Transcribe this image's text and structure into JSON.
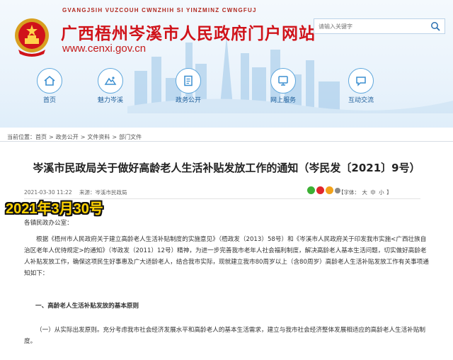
{
  "header": {
    "pinyin": "GVANGJSIH VUZCOUH CWNZHIH SI YINZMINZ CWNGFUJ",
    "title": "广西梧州岑溪市人民政府门户网站",
    "url": "www.cenxi.gov.cn",
    "search_placeholder": "请输入关键字"
  },
  "nav": [
    {
      "label": "首页",
      "icon": "home-icon"
    },
    {
      "label": "魅力岑溪",
      "icon": "scenery-icon"
    },
    {
      "label": "政务公开",
      "icon": "document-icon"
    },
    {
      "label": "网上服务",
      "icon": "service-icon"
    },
    {
      "label": "互动交流",
      "icon": "chat-icon"
    }
  ],
  "breadcrumb": {
    "prefix": "当前位置：",
    "items": [
      "首页",
      "政务公开",
      "文件资料",
      "部门文件"
    ],
    "separator": ">"
  },
  "article": {
    "title": "岑溪市民政局关于做好高龄老人生活补贴发放工作的通知（岑民发〔2021〕9号）",
    "date": "2021-03-30 11:22",
    "source": "来源：岑溪市民政局",
    "fontsize_label": "【字体：",
    "fontsize_options": [
      "大",
      "中",
      "小"
    ],
    "fontsize_end": "】",
    "greeting": "各镇民政办公室：",
    "paragraph1": "根据《梧州市人民政府关于建立高龄老人生活补贴制度的实施意见》（梧政发（2013）58号）和《岑溪市人民政府关于印发我市实施<广西壮族自治区老年人优待规定>的通知》（岑政发（2011）12号）精神，为进一步完善我市老年人社会福利制度，解决高龄老人基本生活问题，切实做好高龄老人补贴发放工作，确保这项民生好事惠及广大适龄老人，结合我市实际，现就建立我市80周岁以上（含80周岁）高龄老人生活补贴发放工作有关事项通知如下：",
    "heading1": "一、高龄老人生活补贴发放的基本原则",
    "paragraph2": "（一）从实际出发原则。充分考虑我市社会经济发展水平和高龄老人的基本生活需求，建立与我市社会经济整体发展相适应的高龄老人生活补贴制度。"
  },
  "overlay": {
    "date_text": "2021年3月30号"
  },
  "colors": {
    "title_red": "#d0131a",
    "nav_blue": "#1e5e9a",
    "overlay_yellow": "#ffd200"
  }
}
